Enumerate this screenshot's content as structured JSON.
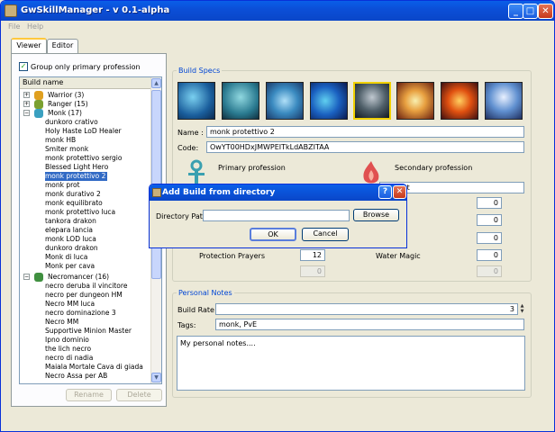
{
  "window": {
    "title": "GwSkillManager - v 0.1-alpha"
  },
  "menu": {
    "file": "File",
    "help": "Help"
  },
  "tabs": {
    "viewer": "Viewer",
    "editor": "Editor"
  },
  "left": {
    "group_checkbox_label": "Group only primary profession",
    "tree_header": "Build name",
    "groups": [
      {
        "label": "Warrior (3)",
        "color": "#e0a020"
      },
      {
        "label": "Ranger (15)",
        "color": "#7aa030"
      },
      {
        "label": "Monk (17)",
        "color": "#3aa0c0"
      },
      {
        "label": "Necromancer (16)",
        "color": "#409040"
      }
    ],
    "monk_builds": [
      "dunkoro crativo",
      "Holy Haste LoD Healer",
      "monk HB",
      "Smiter monk",
      "monk protettivo sergio",
      "Blessed Light Hero",
      "monk protettivo 2",
      "monk prot",
      "monk durativo 2",
      "monk equilibrato",
      "monk protettivo luca",
      "tankora drakon",
      "elepara lancia",
      "monk LOD luca",
      "dunkoro drakon",
      "Monk di luca",
      "Monk per cava"
    ],
    "necro_builds": [
      "necro deruba il vincitore",
      "necro per dungeon HM",
      "Necro MM luca",
      "necro dominazione 3",
      "Necro MM",
      "Supportive Minion Master",
      "Ipno dominio",
      "the lich necro",
      "necro di nadia",
      "Maiala Mortale Cava di giada",
      "Necro Assa per AB"
    ],
    "rename_button": "Rename",
    "delete_button": "Delete"
  },
  "build_specs": {
    "group_label": "Build Specs",
    "name_label": "Name :",
    "name_value": "monk protettivo 2",
    "code_label": "Code:",
    "code_value": "OwYT00HDxJMWPEITkLdABZITAA",
    "primary_label": "Primary profession",
    "secondary_label": "Secondary profession",
    "secondary_value": "entalist",
    "attr_left_label": "Protection Prayers",
    "attr_left_value": "12",
    "attr_right_label": "Water Magic",
    "attr_values": [
      "0",
      "0",
      "0",
      "0",
      "0"
    ],
    "disabled_values": [
      "0",
      "0"
    ]
  },
  "notes": {
    "group_label": "Personal Notes",
    "build_rate_label": "Build Rate :",
    "build_rate_value": "3",
    "tags_label": "Tags:",
    "tags_value": "monk, PvE",
    "notes_text": "My personal notes...."
  },
  "dialog": {
    "title": "Add Build from directory",
    "path_label": "Directory Path",
    "path_value": "",
    "browse_button": "Browse",
    "ok_button": "OK",
    "cancel_button": "Cancel"
  },
  "colors": {
    "titlebar": "#0a55e0",
    "selection": "#316ac5",
    "group_label": "#0046d5"
  },
  "icons": [
    "help-icon",
    "close-icon",
    "minimize-icon",
    "maximize-icon",
    "monk-profession-icon",
    "elementalist-profession-icon"
  ]
}
